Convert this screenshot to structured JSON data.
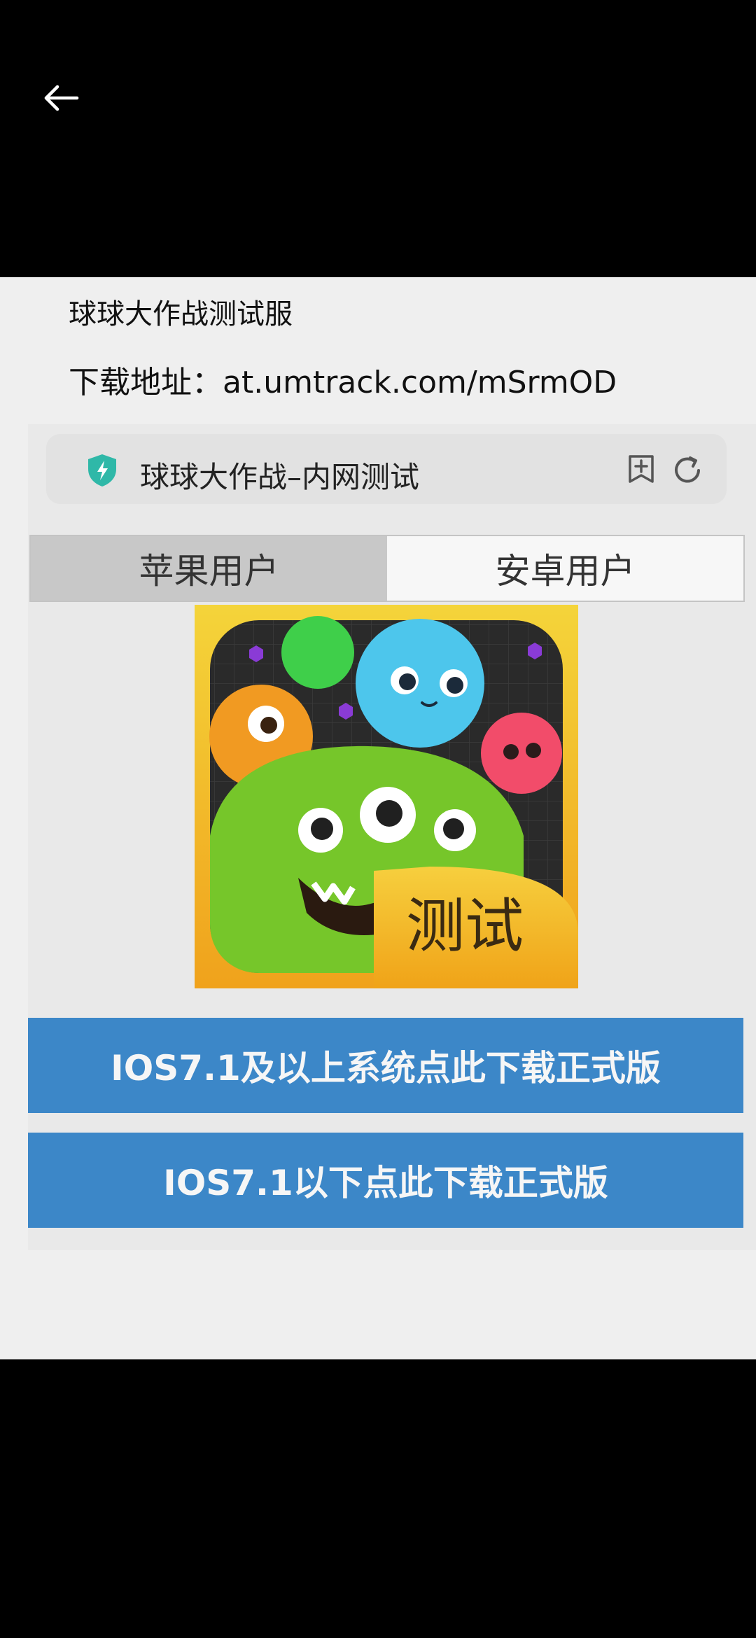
{
  "header": {
    "back_icon": "arrow-left-icon"
  },
  "photo": {
    "game_title": "球球大作战测试服",
    "download_address": "下载地址：at.umtrack.com/mSrmOD",
    "browser": {
      "security_icon": "shield-icon",
      "page_title": "球球大作战–内网测试",
      "bookmark_icon": "bookmark-add-icon",
      "refresh_icon": "refresh-icon"
    },
    "tabs": [
      {
        "label": "苹果用户",
        "active": true
      },
      {
        "label": "安卓用户",
        "active": false
      }
    ],
    "app_icon": {
      "badge_text": "测试"
    },
    "buttons": [
      {
        "label": "IOS7.1及以上系统点此下载正式版"
      },
      {
        "label": "IOS7.1以下点此下载正式版"
      }
    ]
  },
  "colors": {
    "button_blue": "#3c87c8",
    "tab_active": "#c8c8c8",
    "shield_teal": "#2fb8a8",
    "icon_yellow": "#f3c020"
  }
}
